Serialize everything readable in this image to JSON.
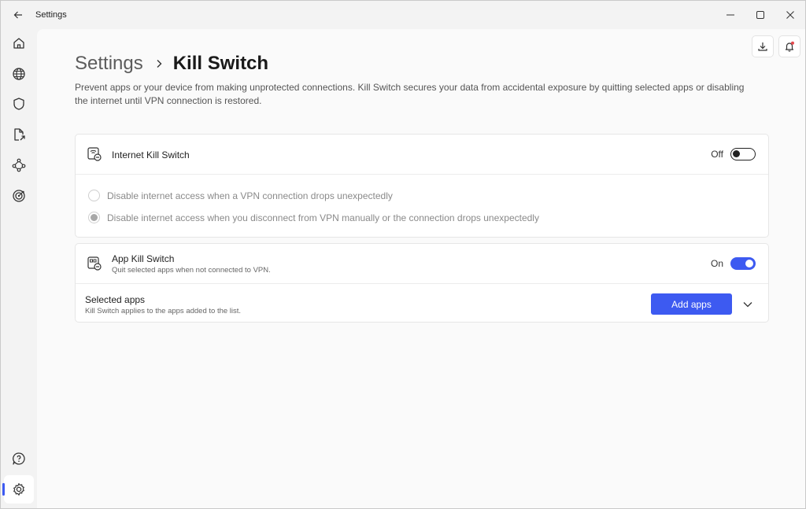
{
  "window": {
    "title": "Settings"
  },
  "breadcrumb": {
    "parent": "Settings",
    "current": "Kill Switch"
  },
  "description": "Prevent apps or your device from making unprotected connections. Kill Switch secures your data from accidental exposure by quitting selected apps or disabling the internet until VPN connection is restored.",
  "internet_kill_switch": {
    "title": "Internet Kill Switch",
    "toggle_label": "Off",
    "options": [
      {
        "label": "Disable internet access when a VPN connection drops unexpectedly",
        "selected": false
      },
      {
        "label": "Disable internet access when you disconnect from VPN manually or the connection drops unexpectedly",
        "selected": true
      }
    ]
  },
  "app_kill_switch": {
    "title": "App Kill Switch",
    "subtitle": "Quit selected apps when not connected to VPN.",
    "toggle_label": "On",
    "selected_apps": {
      "title": "Selected apps",
      "subtitle": "Kill Switch applies to the apps added to the list.",
      "add_button": "Add apps"
    }
  },
  "sidebar": {
    "items": [
      {
        "icon": "home-icon"
      },
      {
        "icon": "globe-icon"
      },
      {
        "icon": "shield-icon"
      },
      {
        "icon": "file-share-icon"
      },
      {
        "icon": "mesh-network-icon"
      },
      {
        "icon": "target-icon"
      },
      {
        "icon": "help-icon"
      },
      {
        "icon": "gear-icon",
        "active": true
      }
    ]
  },
  "colors": {
    "accent": "#3d5af1",
    "notification_dot": "#e5484d"
  }
}
